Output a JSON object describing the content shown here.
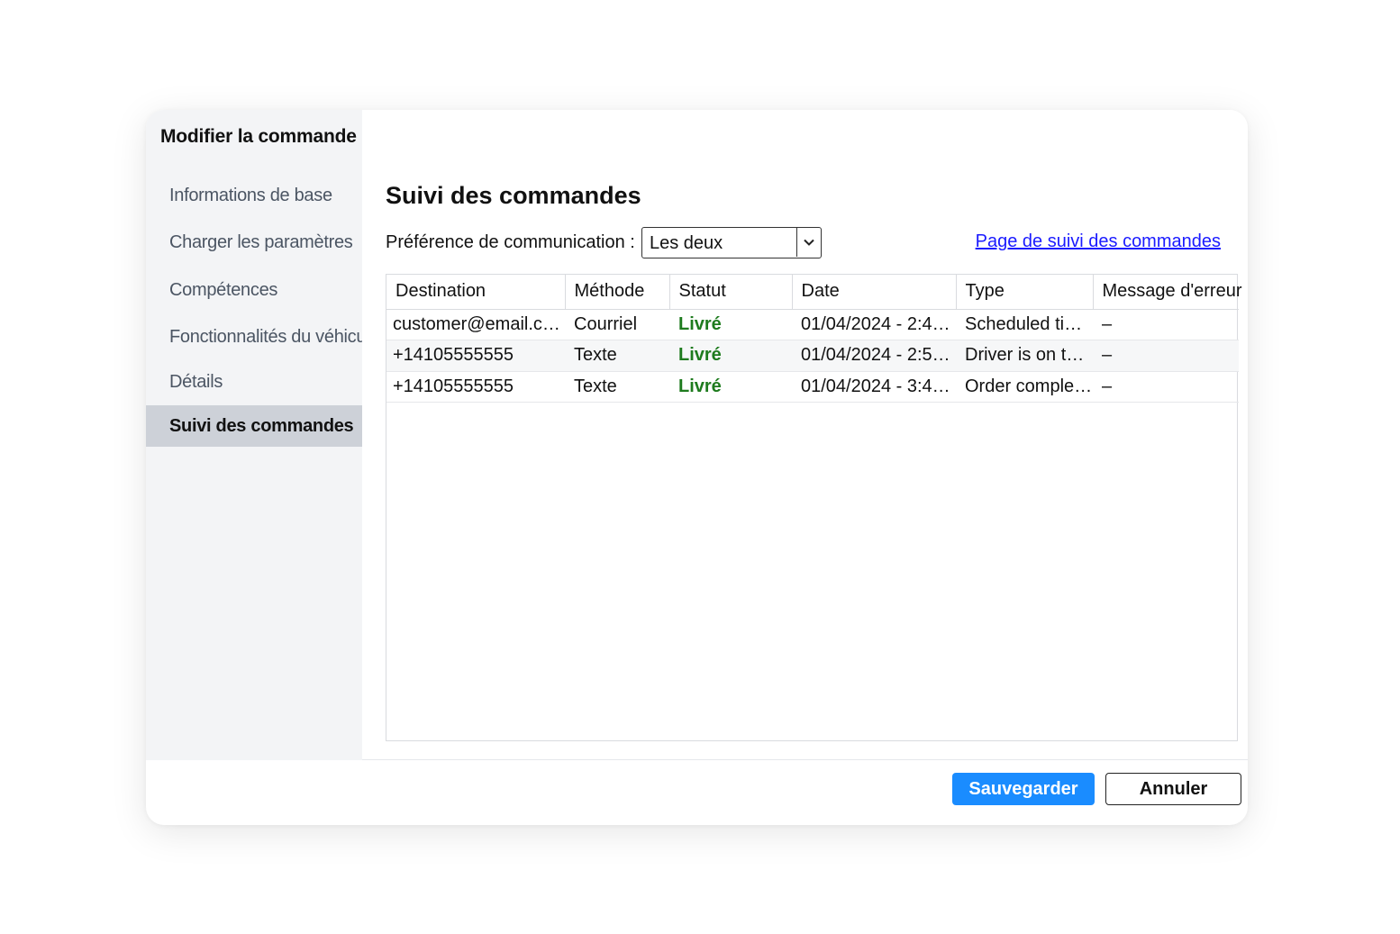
{
  "dialog": {
    "title": "Modifier la commande"
  },
  "sidebar": {
    "items": [
      {
        "label": "Informations de base"
      },
      {
        "label": "Charger les paramètres"
      },
      {
        "label": "Compétences"
      },
      {
        "label": "Fonctionnalités du véhicule"
      },
      {
        "label": "Détails"
      },
      {
        "label": "Suivi des commandes",
        "active": true
      }
    ]
  },
  "main": {
    "title": "Suivi des commandes",
    "preference_label": "Préférence de communication :",
    "preference_value": "Les deux",
    "tracking_link": "Page de suivi des commandes",
    "table": {
      "columns": [
        "Destination",
        "Méthode",
        "Statut",
        "Date",
        "Type",
        "Message d'erreur"
      ],
      "rows": [
        [
          "customer@email.com",
          "Courriel",
          "Livré",
          "01/04/2024 - 2:4…",
          "Scheduled ti…",
          "–"
        ],
        [
          "+14105555555",
          "Texte",
          "Livré",
          "01/04/2024 - 2:5…",
          "Driver is on th…",
          "–"
        ],
        [
          "+14105555555",
          "Texte",
          "Livré",
          "01/04/2024 - 3:4…",
          "Order comple…",
          "–"
        ]
      ]
    }
  },
  "footer": {
    "save_label": "Sauvegarder",
    "cancel_label": "Annuler"
  },
  "colors": {
    "accent": "#1a8cff",
    "link": "#1a1aff",
    "status_delivered": "#1e7b1e",
    "sidebar_bg": "#f3f4f6",
    "sidebar_active_bg": "#cdd1d8"
  },
  "icons": {
    "select_arrow": "chevron-down-icon"
  }
}
